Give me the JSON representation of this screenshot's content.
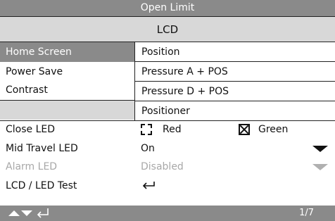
{
  "title": "Open Limit",
  "tab": "LCD",
  "menu": {
    "items": [
      {
        "label": "Home Screen",
        "selected": true
      },
      {
        "label": "Power Save",
        "selected": false
      },
      {
        "label": "Contrast",
        "selected": false
      }
    ]
  },
  "dropdown": {
    "options": [
      "Position",
      "Pressure A + POS",
      "Pressure D + POS",
      "Positioner"
    ]
  },
  "settings": {
    "close_led": {
      "label": "Close LED",
      "option_red": "Red",
      "option_green": "Green",
      "selected": "Green"
    },
    "mid_travel_led": {
      "label": "Mid Travel LED",
      "value": "On"
    },
    "alarm_led": {
      "label": "Alarm LED",
      "value": "Disabled"
    },
    "lcd_led_test": {
      "label": "LCD / LED Test",
      "value_icon": "enter-icon"
    }
  },
  "footer": {
    "nav_icons": [
      "up-arrow-icon",
      "down-arrow-icon",
      "enter-icon"
    ],
    "page": "1/7"
  },
  "colors": {
    "header_gray": "#8a8a8a",
    "tab_gray": "#d8d8d8",
    "disabled_text": "#a8a8a8"
  }
}
